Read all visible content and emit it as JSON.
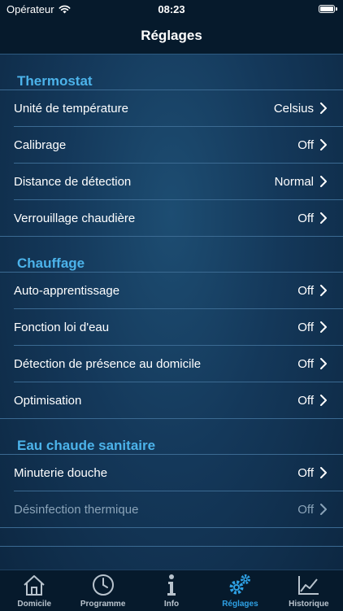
{
  "status_bar": {
    "carrier": "Opérateur",
    "time": "08:23"
  },
  "nav": {
    "title": "Réglages"
  },
  "colors": {
    "accent": "#4cb3ea",
    "active_tab": "#2ea0e4",
    "background": "#14385a"
  },
  "sections": [
    {
      "header": "Thermostat",
      "rows": [
        {
          "label": "Unité de température",
          "value": "Celsius"
        },
        {
          "label": "Calibrage",
          "value": "Off"
        },
        {
          "label": "Distance de détection",
          "value": "Normal"
        },
        {
          "label": "Verrouillage chaudière",
          "value": "Off"
        }
      ]
    },
    {
      "header": "Chauffage",
      "rows": [
        {
          "label": "Auto-apprentissage",
          "value": "Off"
        },
        {
          "label": "Fonction loi d'eau",
          "value": "Off"
        },
        {
          "label": "Détection de présence au domicile",
          "value": "Off"
        },
        {
          "label": "Optimisation",
          "value": "Off"
        }
      ]
    },
    {
      "header": "Eau chaude sanitaire",
      "rows": [
        {
          "label": "Minuterie douche",
          "value": "Off"
        },
        {
          "label": "Désinfection thermique",
          "value": "Off",
          "disabled": true
        }
      ]
    }
  ],
  "tabs": [
    {
      "label": "Domicile",
      "icon": "home-icon"
    },
    {
      "label": "Programme",
      "icon": "clock-icon"
    },
    {
      "label": "Info",
      "icon": "info-icon"
    },
    {
      "label": "Réglages",
      "icon": "gears-icon",
      "active": true
    },
    {
      "label": "Historique",
      "icon": "chart-icon"
    }
  ]
}
